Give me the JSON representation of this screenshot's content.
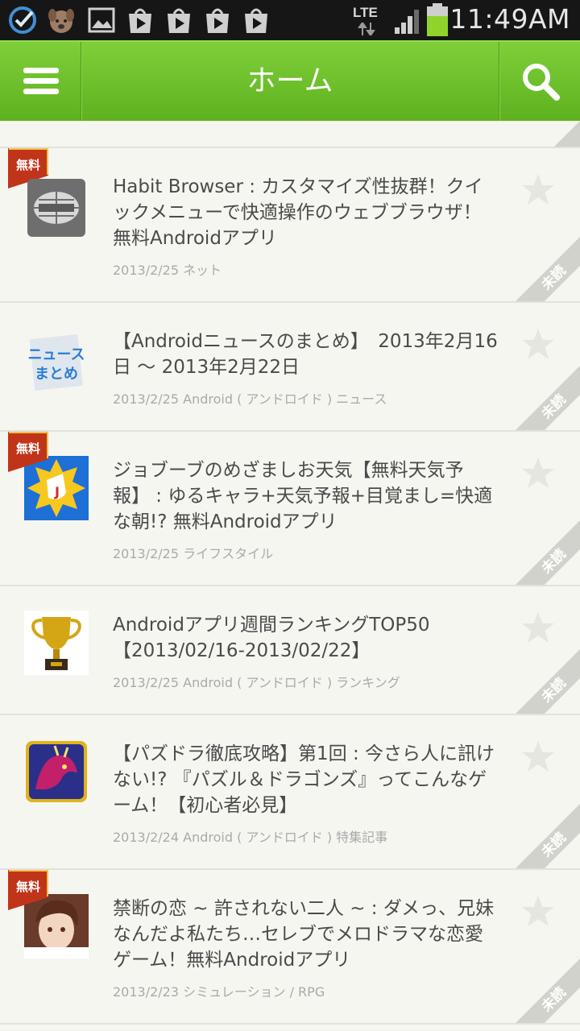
{
  "status_bar": {
    "network": "LTE",
    "time": "11:49AM"
  },
  "appbar": {
    "title": "ホーム",
    "menu_icon": "hamburger-menu-icon",
    "search_icon": "search-icon",
    "accent": "#6cbf2a"
  },
  "badges": {
    "free": "無料",
    "unread": "未読"
  },
  "articles": [
    {
      "title": "Habit Browser : カスタマイズ性抜群！クイックメニューで快適操作のウェブブラウザ！無料Androidアプリ",
      "meta": "2013/2/25 ネット",
      "free": true,
      "unread": true,
      "icon": "habit-browser-icon"
    },
    {
      "title": "【Androidニュースのまとめ】　2013年2月16日 ～ 2013年2月22日",
      "meta": "2013/2/25 Android ( アンドロイド ) ニュース",
      "free": false,
      "unread": true,
      "icon": "news-matome-icon"
    },
    {
      "title": "ジョブーブのめざましお天気【無料天気予報】 : ゆるキャラ+天気予報+目覚まし=快適な朝!? 無料Androidアプリ",
      "meta": "2013/2/25 ライフスタイル",
      "free": true,
      "unread": true,
      "icon": "weather-app-icon"
    },
    {
      "title": "Androidアプリ週間ランキングTOP50【2013/02/16-2013/02/22】",
      "meta": "2013/2/25 Android ( アンドロイド ) ランキング",
      "free": false,
      "unread": true,
      "icon": "trophy-icon"
    },
    {
      "title": "【パズドラ徹底攻略】第1回 : 今さら人に訊けない!? 『パズル＆ドラゴンズ』ってこんなゲーム！【初心者必見】",
      "meta": "2013/2/24 Android ( アンドロイド ) 特集記事",
      "free": false,
      "unread": true,
      "icon": "dragon-game-icon"
    },
    {
      "title": "禁断の恋 ~ 許されない二人 ~ : ダメっ、兄妹なんだよ私たち…セレブでメロドラマな恋愛ゲーム！無料Androidアプリ",
      "meta": "2013/2/23 シミュレーション / RPG",
      "free": true,
      "unread": true,
      "icon": "romance-game-icon"
    }
  ]
}
